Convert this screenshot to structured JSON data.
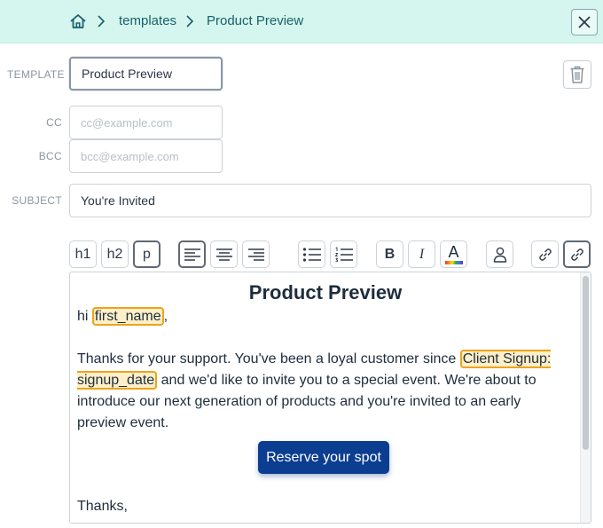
{
  "breadcrumb": {
    "home_icon": "home-icon",
    "items": [
      "templates",
      "Product Preview"
    ]
  },
  "header": {
    "close_icon": "close-icon"
  },
  "form": {
    "template": {
      "label": "TEMPLATE",
      "value": "Product Preview"
    },
    "cc": {
      "label": "CC",
      "placeholder": "cc@example.com",
      "value": ""
    },
    "bcc": {
      "label": "BCC",
      "placeholder": "bcc@example.com",
      "value": ""
    },
    "subject": {
      "label": "SUBJECT",
      "value": "You're Invited"
    },
    "delete_icon": "trash-icon"
  },
  "toolbar": {
    "h1": "h1",
    "h2": "h2",
    "p": "p",
    "active": [
      "p",
      "align-left"
    ],
    "icons": [
      "align-left-icon",
      "align-center-icon",
      "align-right-icon",
      "bullet-list-icon",
      "numbered-list-icon",
      "bold-icon",
      "italic-icon",
      "text-color-icon",
      "person-icon",
      "link-icon",
      "unlink-icon"
    ],
    "bold": "B",
    "italic": "I",
    "text_color": "A"
  },
  "editor": {
    "title": "Product Preview",
    "greeting": "hi",
    "greeting_tag": "first_name",
    "greeting_punct": ",",
    "para_start": "Thanks for your support.  You've been a loyal customer since",
    "para_tag_part1": "Client Signup:",
    "para_tag_part2": "signup_date",
    "para_end": "and we'd like to invite you to a special event.  We're about to introduce our next generation of products and you're invited to an early preview event.",
    "button_label": "Reserve your spot",
    "closing": "Thanks,"
  },
  "colors": {
    "topbar": "#d4f6ee",
    "button": "#0b3d91",
    "tag_border": "#f0a21c",
    "tag_fill": "#fdefc8"
  }
}
